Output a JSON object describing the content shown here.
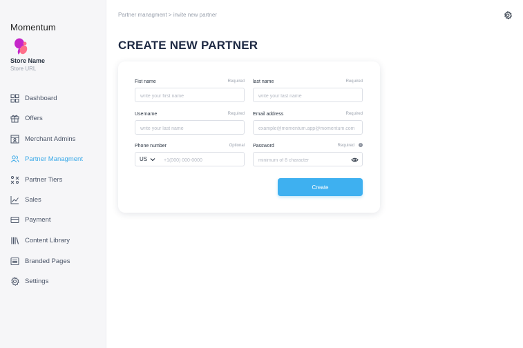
{
  "sidebar": {
    "brand": "Momentum",
    "store_name": "Store Name",
    "store_url": "Store URL",
    "items": [
      {
        "label": "Dashboard",
        "icon": "dashboard-icon"
      },
      {
        "label": "Offers",
        "icon": "gift-icon"
      },
      {
        "label": "Merchant Admins",
        "icon": "merchant-icon"
      },
      {
        "label": "Partner Managment",
        "icon": "users-icon",
        "active": true
      },
      {
        "label": "Partner Tiers",
        "icon": "tiers-icon"
      },
      {
        "label": "Sales",
        "icon": "chart-icon"
      },
      {
        "label": "Payment",
        "icon": "card-icon"
      },
      {
        "label": "Content Library",
        "icon": "library-icon"
      },
      {
        "label": "Branded Pages",
        "icon": "pages-icon"
      },
      {
        "label": "Settings",
        "icon": "gear-icon"
      }
    ]
  },
  "header": {
    "breadcrumb": "Partner managment > invite new partner"
  },
  "page_title": "CREATE NEW PARTNER",
  "form": {
    "first_name": {
      "label": "Fist name",
      "req": "Required",
      "placeholder": "write your first name",
      "value": ""
    },
    "last_name": {
      "label": "last name",
      "req": "Required",
      "placeholder": "write your last name",
      "value": ""
    },
    "username": {
      "label": "Username",
      "req": "Required",
      "placeholder": "write your last name",
      "value": ""
    },
    "email": {
      "label": "Email address",
      "req": "Required",
      "placeholder": "example@momentum.app@momentum.com",
      "value": ""
    },
    "phone": {
      "label": "Phone number",
      "req": "Optional",
      "country": "US",
      "placeholder": "+1(000) 000-0000",
      "value": ""
    },
    "password": {
      "label": "Password",
      "req": "Required",
      "placeholder": "minimum of 8 character",
      "value": ""
    },
    "create_label": "Create"
  },
  "colors": {
    "accent": "#3aa9e8",
    "button": "#3eb0f0",
    "title": "#1f2a44"
  }
}
